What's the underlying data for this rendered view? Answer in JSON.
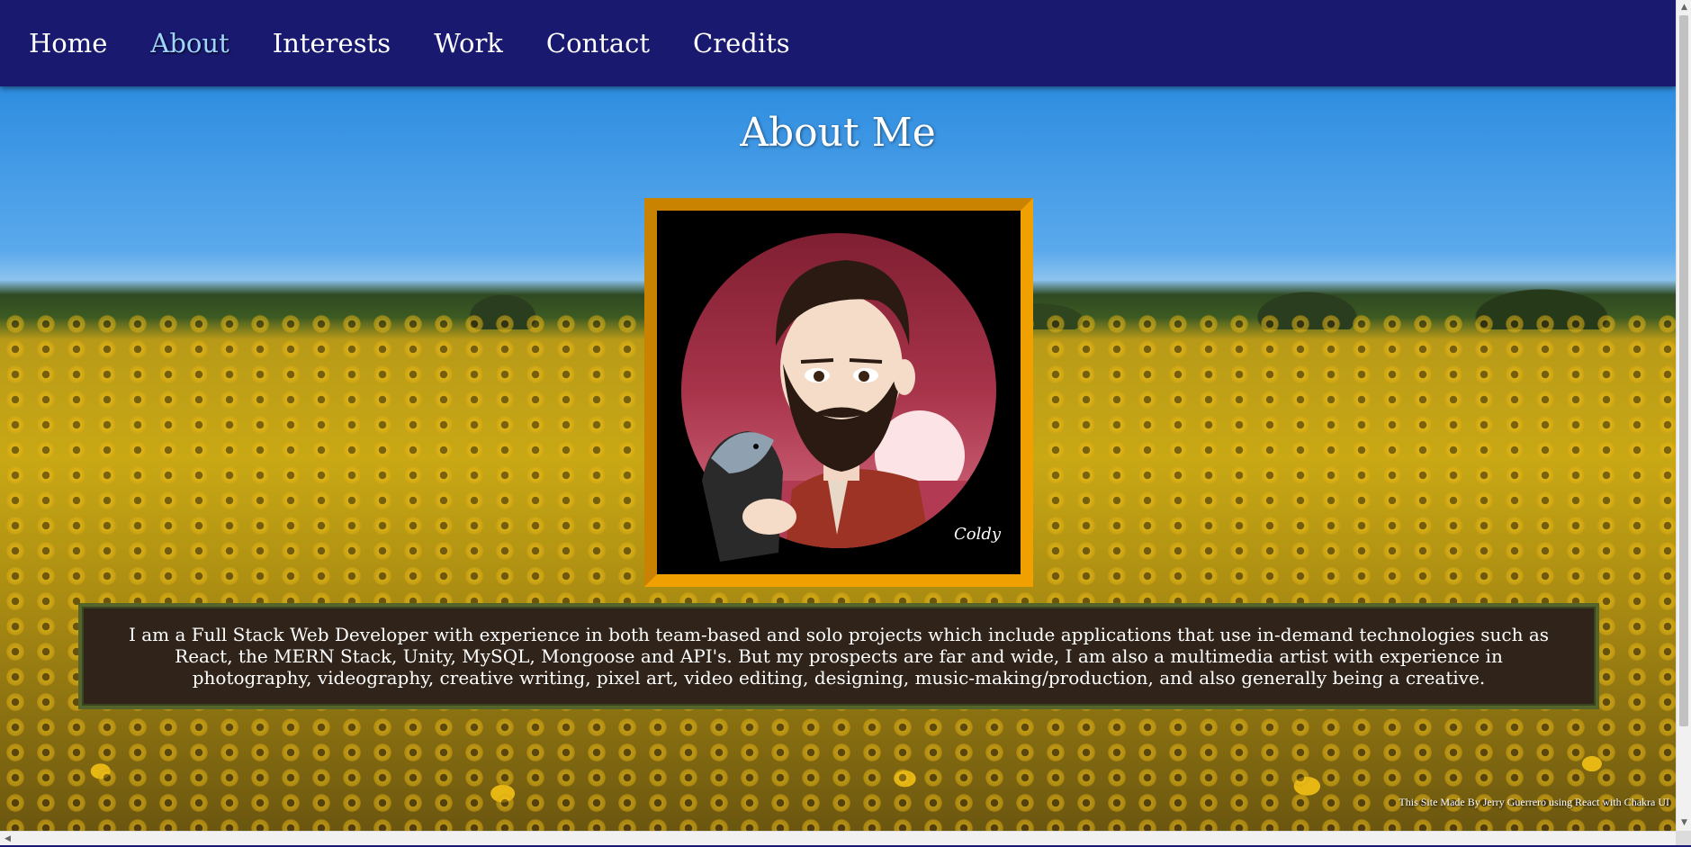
{
  "nav": {
    "items": [
      {
        "label": "Home"
      },
      {
        "label": "About"
      },
      {
        "label": "Interests"
      },
      {
        "label": "Work"
      },
      {
        "label": "Contact"
      },
      {
        "label": "Credits"
      }
    ],
    "active": "About"
  },
  "main": {
    "title": "About Me",
    "portrait": {
      "icon": "avatar-illustration",
      "signature": "Coldy"
    },
    "bio": "I am a Full Stack Web Developer with experience in both team-based and solo projects which include applications that use in-demand technologies such as React, the MERN Stack, Unity, MySQL, Mongoose and API's. But my prospects are far and wide, I am also a multimedia artist with experience in photography, videography, creative writing, pixel art, video editing, designing, music-making/production, and also generally being a creative."
  },
  "footer": {
    "credit": "This Site Made By Jerry Guerrero using React with Chakra UI"
  },
  "colors": {
    "navbar": "#191970",
    "frame": "#f0a000",
    "bio_bg": "#30241a",
    "bio_border": "#55642a"
  }
}
